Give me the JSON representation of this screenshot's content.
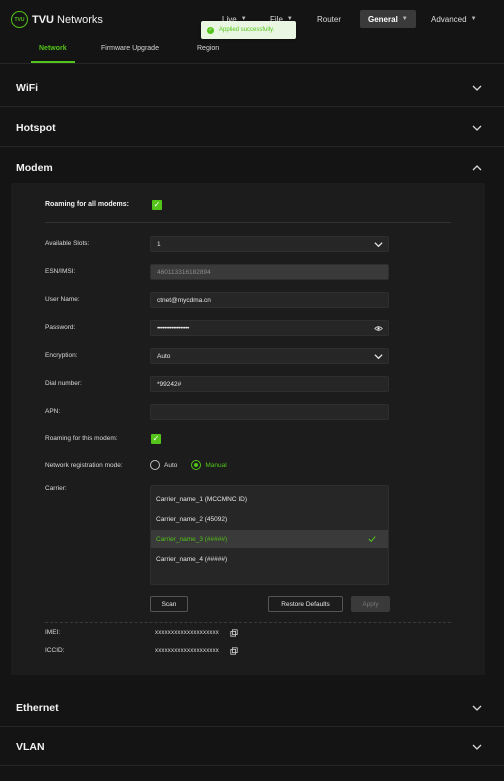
{
  "header": {
    "logo_badge": "TVU",
    "logo_text_bold": "TVU",
    "logo_text_rest": " Networks",
    "nav": [
      {
        "label": "Live"
      },
      {
        "label": "File"
      },
      {
        "label": "Router"
      },
      {
        "label": "General"
      },
      {
        "label": "Advanced"
      }
    ],
    "active_nav": "General"
  },
  "toast": {
    "message": "Applied successfully."
  },
  "tabs": [
    {
      "label": "Network",
      "active": true
    },
    {
      "label": "Firmware Upgrade",
      "active": false
    },
    {
      "label": "Region",
      "active": false
    }
  ],
  "sections": {
    "wifi": "WiFi",
    "hotspot": "Hotspot",
    "modem": "Modem",
    "ethernet": "Ethernet",
    "vlan": "VLAN"
  },
  "modem": {
    "roaming_all_label": "Roaming for all modems:",
    "roaming_all_checked": true,
    "fields": {
      "available_slots": {
        "label": "Available Slots:",
        "value": "1"
      },
      "esn_imsi": {
        "label": "ESN/IMSI:",
        "value": "460113316182894"
      },
      "user_name": {
        "label": "User Name:",
        "value": "ctnet@mycdma.cn"
      },
      "password": {
        "label": "Password:",
        "value": "••••••••••••••••••"
      },
      "encryption": {
        "label": "Encryption:",
        "value": "Auto"
      },
      "dial_number": {
        "label": "Dial number:",
        "value": "*99242#"
      },
      "apn": {
        "label": "APN:",
        "value": ""
      }
    },
    "roaming_this_label": "Roaming for this modem:",
    "roaming_this_checked": true,
    "reg_mode_label": "Network registration mode:",
    "reg_mode_options": [
      "Auto",
      "Manual"
    ],
    "reg_mode_selected": "Manual",
    "carrier_label": "Carrier:",
    "carriers": [
      "Carrier_name_1 (MCCMNC ID)",
      "Carrier_name_2 (45092)",
      "Carrier_name_3 (#####)",
      "Carrier_name_4 (#####)"
    ],
    "selected_carrier_index": 2,
    "buttons": {
      "scan": "Scan",
      "restore": "Restore Defaults",
      "apply": "Apply"
    },
    "imei_label": "IMEI:",
    "imei_value": "xxxxxxxxxxxxxxxxxxxx",
    "iccid_label": "ICCID:",
    "iccid_value": "xxxxxxxxxxxxxxxxxxxx"
  },
  "colors": {
    "accent": "#52c41a",
    "background": "#141414",
    "panel": "#1c1c1c"
  }
}
